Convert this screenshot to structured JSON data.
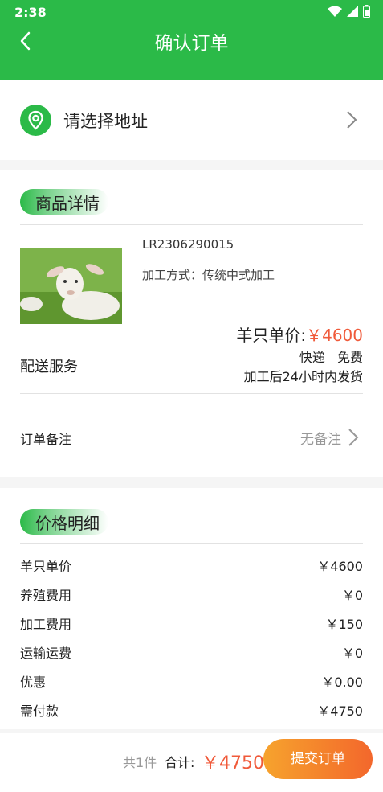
{
  "status_bar": {
    "time": "2:38"
  },
  "header": {
    "title": "确认订单"
  },
  "address": {
    "placeholder_text": "请选择地址"
  },
  "goods": {
    "section_title": "商品详情",
    "sku": "LR2306290015",
    "process_label": "加工方式：",
    "process_value": "传统中式加工",
    "unit_price_label": "羊只单价:",
    "unit_price_value": "￥4600",
    "delivery_label": "配送服务",
    "delivery_method": "快递 免费",
    "ship_time": "加工后24小时内发货",
    "remark_label": "订单备注",
    "remark_value": "无备注"
  },
  "price_detail": {
    "section_title": "价格明细",
    "rows": [
      {
        "label": "羊只单价",
        "value": "￥4600"
      },
      {
        "label": "养殖费用",
        "value": "￥0"
      },
      {
        "label": "加工费用",
        "value": "￥150"
      },
      {
        "label": "运输运费",
        "value": "￥0"
      },
      {
        "label": "优惠",
        "value": "￥0.00"
      },
      {
        "label": "需付款",
        "value": "￥4750"
      }
    ]
  },
  "footer": {
    "count": "共1件",
    "total_label": "合计:",
    "total_value": "￥4750",
    "submit_label": "提交订单"
  },
  "colors": {
    "brand_green": "#2bba48",
    "price_red": "#f05a3a",
    "button_orange": "#f3672c"
  },
  "icons": [
    "back-arrow-icon",
    "location-pin-icon",
    "chevron-right-icon",
    "wifi-icon",
    "signal-icon",
    "battery-icon"
  ]
}
